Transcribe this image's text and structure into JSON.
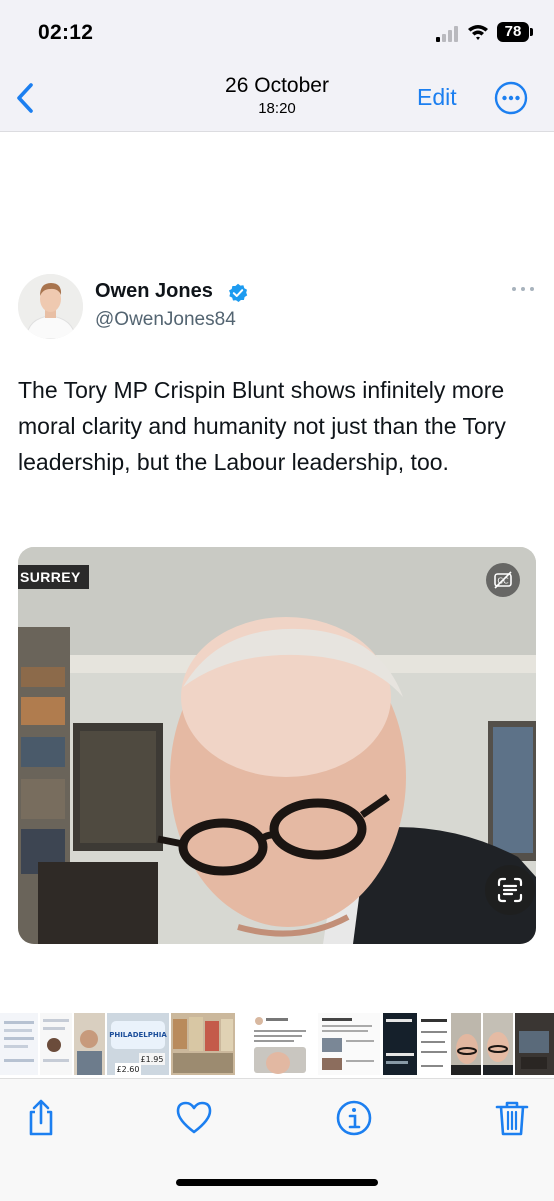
{
  "status_bar": {
    "time": "02:12",
    "battery": "78",
    "icons": [
      "cellular-signal-icon",
      "wifi-icon",
      "battery-icon"
    ]
  },
  "nav": {
    "title": "26 October",
    "subtitle": "18:20",
    "edit_label": "Edit",
    "icons": [
      "chevron-left-icon",
      "more-circle-icon"
    ]
  },
  "tweet": {
    "author_name": "Owen Jones",
    "author_handle": "@OwenJones84",
    "text": "The Tory MP Crispin Blunt shows infinitely more moral clarity and humanity not just than the Tory leadership, but the Labour leadership, too.",
    "media": {
      "channel_tag": "SURREY",
      "icons": [
        "captions-off-icon",
        "live-text-scan-icon"
      ]
    }
  },
  "filmstrip": {
    "price_labels": [
      "£1.95",
      "£2.60"
    ],
    "brand_label": "PHILADELPHIA"
  },
  "toolbar": {
    "icons": [
      "share-icon",
      "heart-icon",
      "info-icon",
      "trash-icon"
    ]
  },
  "colors": {
    "accent": "#1c7ff0",
    "verified": "#1d9bf0",
    "handle_gray": "#536471",
    "bar_background": "#f2f2f7"
  }
}
